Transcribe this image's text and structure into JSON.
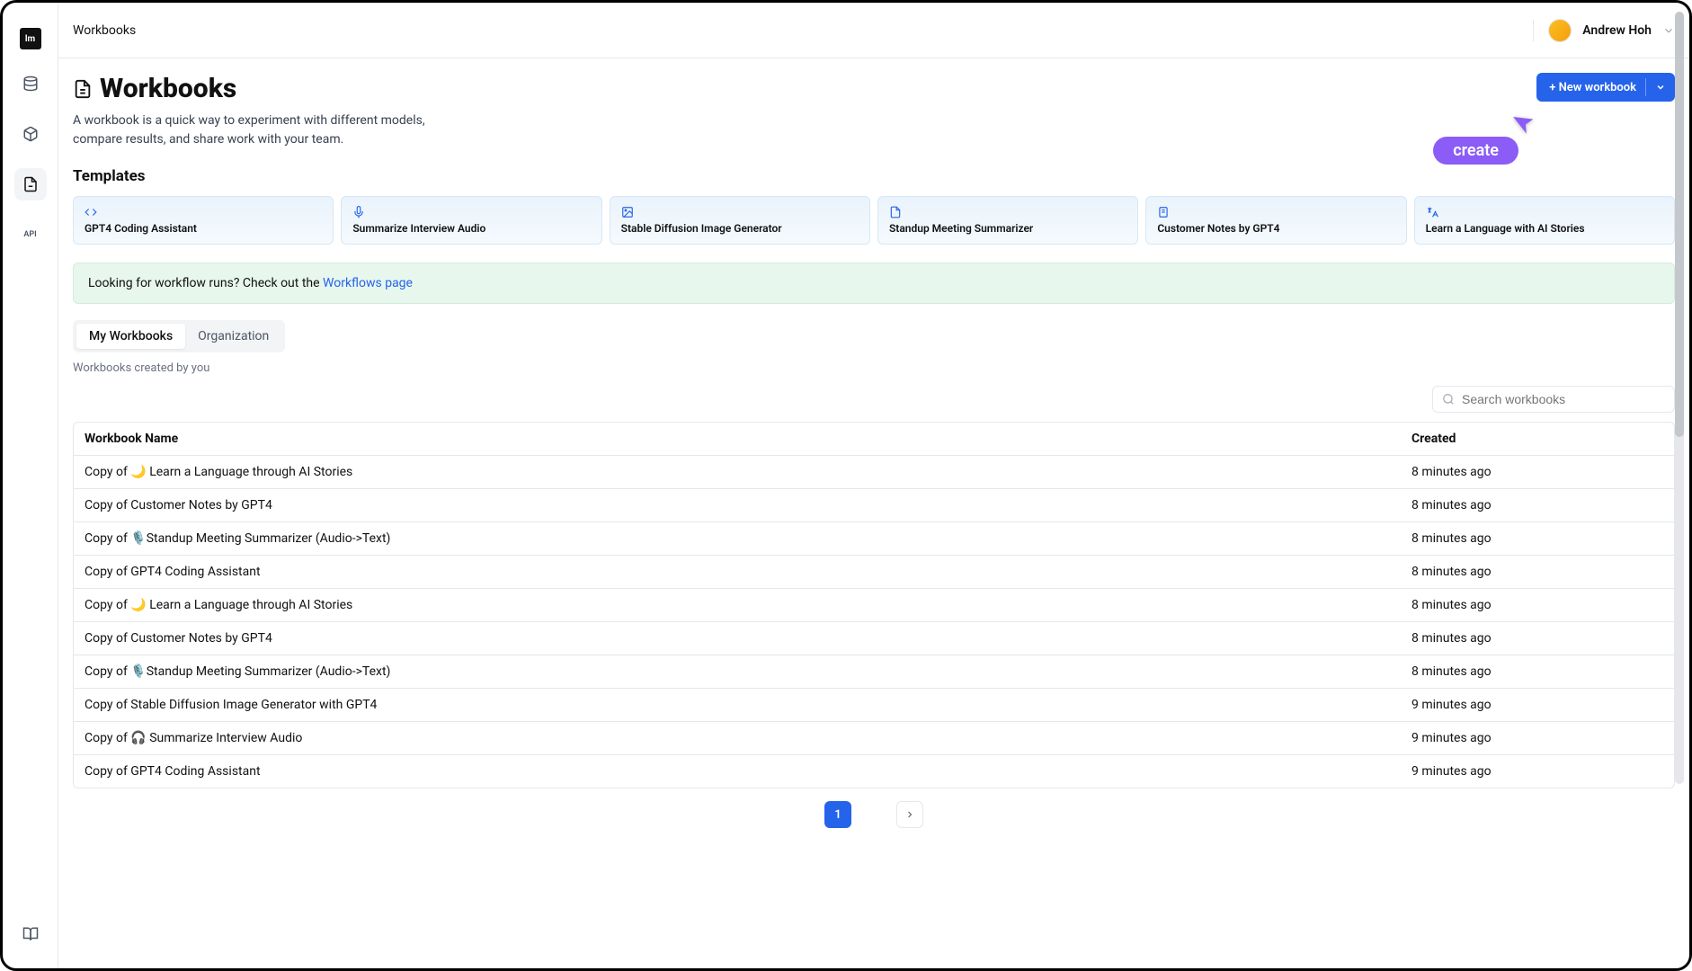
{
  "header": {
    "breadcrumb": "Workbooks",
    "user_name": "Andrew Hoh"
  },
  "page": {
    "title": "Workbooks",
    "description": "A workbook is a quick way to experiment with different models, compare results, and share work with your team.",
    "new_button": "+ New workbook"
  },
  "annotation": {
    "label": "create"
  },
  "templates_section_title": "Templates",
  "templates": [
    {
      "label": "GPT4 Coding Assistant",
      "icon": "code"
    },
    {
      "label": "Summarize Interview Audio",
      "icon": "mic"
    },
    {
      "label": "Stable Diffusion Image Generator",
      "icon": "image"
    },
    {
      "label": "Standup Meeting Summarizer",
      "icon": "doc"
    },
    {
      "label": "Customer Notes by GPT4",
      "icon": "note"
    },
    {
      "label": "Learn a Language with AI Stories",
      "icon": "lang"
    }
  ],
  "banner": {
    "prefix": "Looking for workflow runs? Check out the ",
    "link": "Workflows page"
  },
  "tabs": {
    "my_workbooks": "My Workbooks",
    "organization": "Organization"
  },
  "subtext": "Workbooks created by you",
  "search_placeholder": "Search workbooks",
  "table": {
    "columns": {
      "name": "Workbook Name",
      "created": "Created"
    },
    "rows": [
      {
        "name": "Copy of 🌙 Learn a Language through AI Stories",
        "created": "8 minutes ago"
      },
      {
        "name": "Copy of Customer Notes by GPT4",
        "created": "8 minutes ago"
      },
      {
        "name": "Copy of 🎙️Standup Meeting Summarizer (Audio->Text)",
        "created": "8 minutes ago"
      },
      {
        "name": "Copy of GPT4 Coding Assistant",
        "created": "8 minutes ago"
      },
      {
        "name": "Copy of 🌙 Learn a Language through AI Stories",
        "created": "8 minutes ago"
      },
      {
        "name": "Copy of Customer Notes by GPT4",
        "created": "8 minutes ago"
      },
      {
        "name": "Copy of 🎙️Standup Meeting Summarizer (Audio->Text)",
        "created": "8 minutes ago"
      },
      {
        "name": "Copy of Stable Diffusion Image Generator with GPT4",
        "created": "9 minutes ago"
      },
      {
        "name": "Copy of 🎧 Summarize Interview Audio",
        "created": "9 minutes ago"
      },
      {
        "name": "Copy of GPT4 Coding Assistant",
        "created": "9 minutes ago"
      }
    ]
  },
  "pagination": {
    "current": "1"
  }
}
